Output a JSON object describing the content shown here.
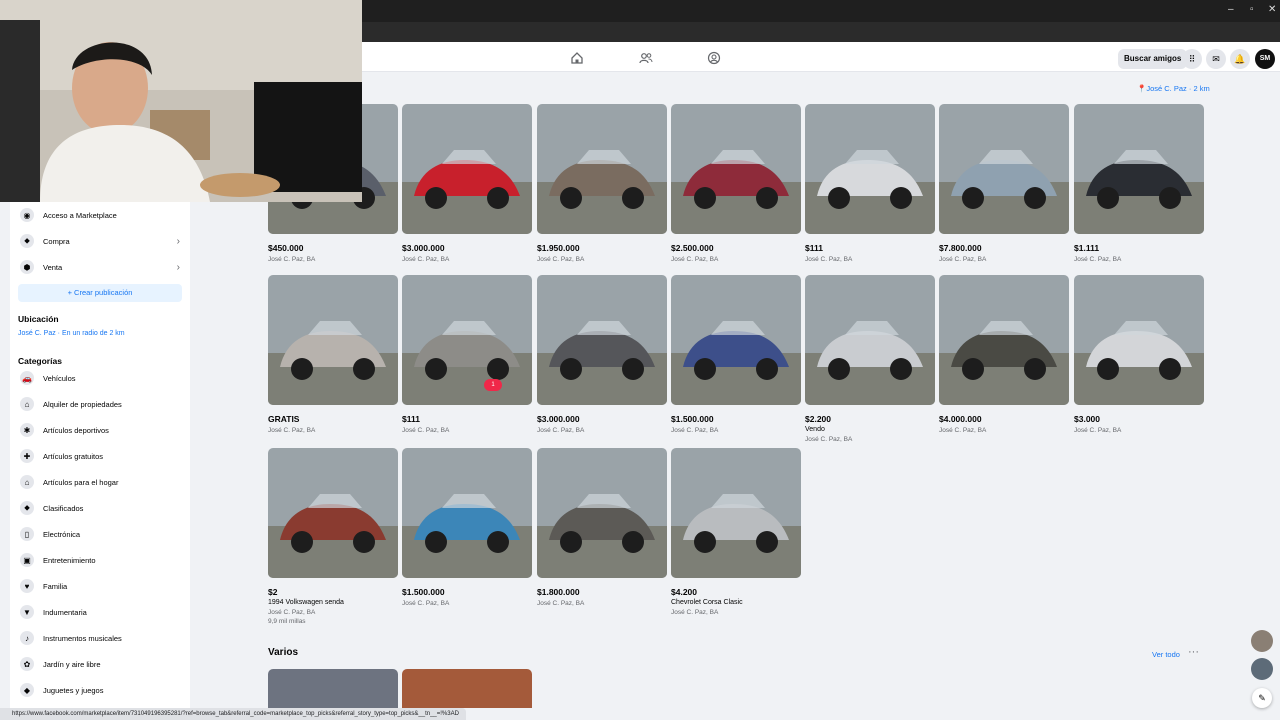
{
  "header": {
    "find_friends_label": "Buscar amigos",
    "avatar_initials": "SM"
  },
  "location_link": "José C. Paz · 2 km",
  "sidebar": {
    "top_items": [
      {
        "label": "Acceso a Marketplace",
        "icon": "marketplace-icon"
      },
      {
        "label": "Compra",
        "icon": "tag-icon"
      },
      {
        "label": "Venta",
        "icon": "sell-icon"
      }
    ],
    "create_label": "+ Crear publicación",
    "location_heading": "Ubicación",
    "location_value": "José C. Paz · En un radio de 2 km",
    "categories_heading": "Categorías",
    "categories": [
      {
        "label": "Vehículos",
        "icon": "car-icon"
      },
      {
        "label": "Alquiler de propiedades",
        "icon": "house-icon"
      },
      {
        "label": "Artículos deportivos",
        "icon": "runner-icon"
      },
      {
        "label": "Artículos gratuitos",
        "icon": "gift-icon"
      },
      {
        "label": "Artículos para el hogar",
        "icon": "home-icon"
      },
      {
        "label": "Clasificados",
        "icon": "tag-icon"
      },
      {
        "label": "Electrónica",
        "icon": "phone-icon"
      },
      {
        "label": "Entretenimiento",
        "icon": "entertainment-icon"
      },
      {
        "label": "Familia",
        "icon": "heart-icon"
      },
      {
        "label": "Indumentaria",
        "icon": "shirt-icon"
      },
      {
        "label": "Instrumentos musicales",
        "icon": "guitar-icon"
      },
      {
        "label": "Jardín y aire libre",
        "icon": "garden-icon"
      },
      {
        "label": "Juguetes y juegos",
        "icon": "toy-icon"
      }
    ]
  },
  "listings": [
    {
      "price": "$450.000",
      "location": "José C. Paz, BA",
      "color": "#5a5f6a"
    },
    {
      "price": "$3.000.000",
      "location": "José C. Paz, BA",
      "color": "#c8202c"
    },
    {
      "price": "$1.950.000",
      "location": "José C. Paz, BA",
      "color": "#7a6c60"
    },
    {
      "price": "$2.500.000",
      "location": "José C. Paz, BA",
      "color": "#8e2b3a"
    },
    {
      "price": "$111",
      "location": "José C. Paz, BA",
      "color": "#d7d9dc"
    },
    {
      "price": "$7.800.000",
      "location": "José C. Paz, BA",
      "color": "#8fa1b0"
    },
    {
      "price": "$1.111",
      "location": "José C. Paz, BA",
      "color": "#2a2d33"
    },
    {
      "price": "GRATIS",
      "location": "José C. Paz, BA",
      "color": "#b7b2ad"
    },
    {
      "price": "$111",
      "location": "José C. Paz, BA",
      "color": "#8d8c88",
      "badge": "1"
    },
    {
      "price": "$3.000.000",
      "location": "José C. Paz, BA",
      "color": "#55565a"
    },
    {
      "price": "$1.500.000",
      "location": "José C. Paz, BA",
      "color": "#3d4f8a"
    },
    {
      "price": "$2.200",
      "title": "Vendo",
      "location": "José C. Paz, BA",
      "color": "#c9ccd0"
    },
    {
      "price": "$4.000.000",
      "location": "José C. Paz, BA",
      "color": "#4a4a44"
    },
    {
      "price": "$3.000",
      "location": "José C. Paz, BA",
      "color": "#d3d5d8"
    },
    {
      "price": "$2",
      "title": "1994 Volkswagen senda",
      "location": "José C. Paz, BA",
      "extra": "9,9 mil millas",
      "color": "#8a3b30"
    },
    {
      "price": "$1.500.000",
      "location": "José C. Paz, BA",
      "color": "#3c86b8"
    },
    {
      "price": "$1.800.000",
      "location": "José C. Paz, BA",
      "color": "#5c5a56"
    },
    {
      "price": "$4.200",
      "title": "Chevrolet Corsa Clasic",
      "location": "José C. Paz, BA",
      "color": "#b9bcbf"
    }
  ],
  "section": {
    "title": "Varios",
    "see_all": "Ver todo",
    "more": "···",
    "previews": [
      {
        "color": "#6d7380"
      },
      {
        "color": "#a45a3a"
      }
    ]
  },
  "status_url": "https://www.facebook.com/marketplace/item/731049196395281/?ref=browse_tab&referral_code=marketplace_top_picks&referral_story_type=top_picks&__tn__=!%3AD"
}
